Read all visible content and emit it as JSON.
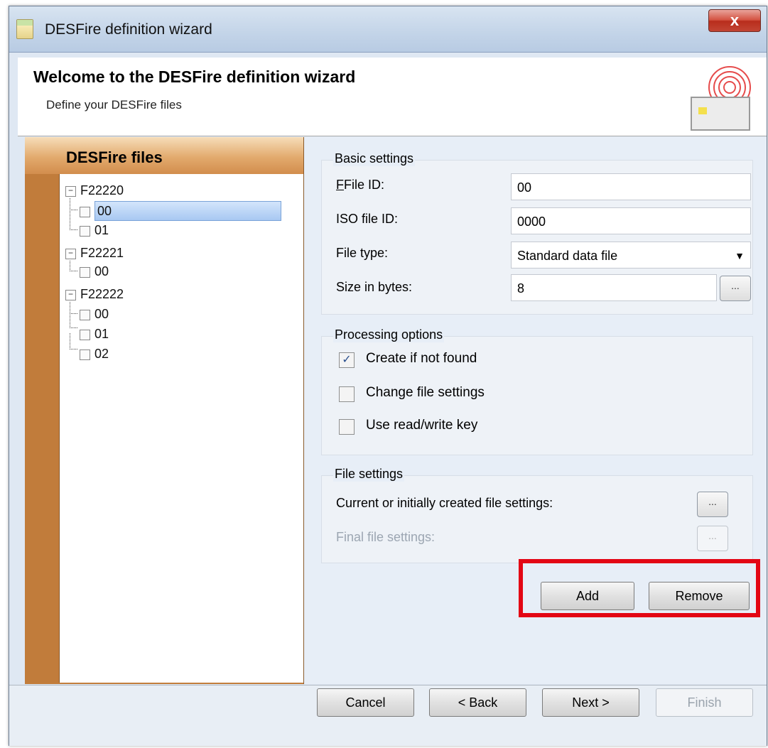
{
  "window": {
    "title": "DESFire definition wizard",
    "close_glyph": "x"
  },
  "header": {
    "title": "Welcome to the DESFire definition wizard",
    "subtitle": "Define your DESFire files",
    "logo_icon": "rfid-card-icon"
  },
  "tree": {
    "title": "DESFire files",
    "items": [
      {
        "label": "F22220",
        "type": "node",
        "expanded": true
      },
      {
        "label": "00",
        "type": "leaf",
        "selected": true
      },
      {
        "label": "01",
        "type": "leaf"
      },
      {
        "label": "F22221",
        "type": "node",
        "expanded": true
      },
      {
        "label": "00",
        "type": "leaf"
      },
      {
        "label": "F22222",
        "type": "node",
        "expanded": true
      },
      {
        "label": "00",
        "type": "leaf"
      },
      {
        "label": "01",
        "type": "leaf"
      },
      {
        "label": "02",
        "type": "leaf"
      }
    ]
  },
  "basic_settings": {
    "title": "Basic settings",
    "file_id_label": "File ID:",
    "file_id_value": "00",
    "iso_file_id_label": "ISO file ID:",
    "iso_file_id_value": "0000",
    "file_type_label": "File type:",
    "file_type_value": "Standard data file",
    "size_label": "Size in bytes:",
    "size_value": "8",
    "browse_label": "..."
  },
  "processing_options": {
    "title": "Processing options",
    "create_if_not_found": {
      "label": "Create if not found",
      "checked": true
    },
    "change_file_settings": {
      "label": "Change file settings",
      "checked": false
    },
    "use_read_write_key": {
      "label": "Use read/write key",
      "checked": false
    }
  },
  "file_settings": {
    "title": "File settings",
    "current_label": "Current or initially created file settings:",
    "final_label": "Final file settings:",
    "browse_label": "..."
  },
  "actions": {
    "add": "Add",
    "remove": "Remove"
  },
  "footer": {
    "cancel": "Cancel",
    "back": "< Back",
    "next": "Next >",
    "finish": "Finish"
  },
  "colors": {
    "highlight": "#e30614",
    "panel_orange": "#c17c3b",
    "selection": "#a8c8f2"
  }
}
